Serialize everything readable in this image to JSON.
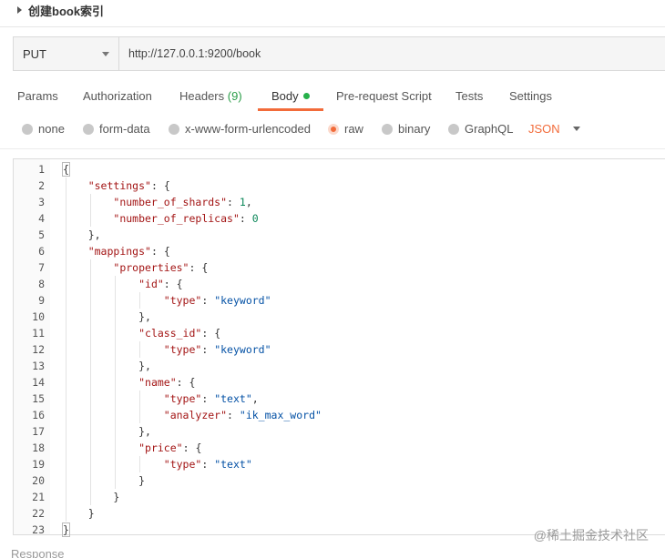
{
  "title": "创建book索引",
  "request": {
    "method": "PUT",
    "url": "http://127.0.0.1:9200/book"
  },
  "tabs": [
    {
      "label": "Params"
    },
    {
      "label": "Authorization"
    },
    {
      "label": "Headers",
      "count": "(9)"
    },
    {
      "label": "Body",
      "active": true
    },
    {
      "label": "Pre-request Script"
    },
    {
      "label": "Tests"
    },
    {
      "label": "Settings"
    }
  ],
  "body_types": [
    {
      "label": "none"
    },
    {
      "label": "form-data"
    },
    {
      "label": "x-www-form-urlencoded"
    },
    {
      "label": "raw",
      "selected": true
    },
    {
      "label": "binary"
    },
    {
      "label": "GraphQL"
    }
  ],
  "format": "JSON",
  "code_lines": [
    "{",
    "    \"settings\": {",
    "        \"number_of_shards\": 1,",
    "        \"number_of_replicas\": 0",
    "    },",
    "    \"mappings\": {",
    "        \"properties\": {",
    "            \"id\": {",
    "                \"type\": \"keyword\"",
    "            },",
    "            \"class_id\": {",
    "                \"type\": \"keyword\"",
    "            },",
    "            \"name\": {",
    "                \"type\": \"text\",",
    "                \"analyzer\": \"ik_max_word\"",
    "            },",
    "            \"price\": {",
    "                \"type\": \"text\"",
    "            }",
    "        }",
    "    }",
    "}"
  ],
  "response_label": "Response",
  "watermark": "@稀土掘金技术社区",
  "colors": {
    "accent": "#f26b3a",
    "active_dot": "#26b04a",
    "json_key": "#a31515",
    "json_string": "#0451a5",
    "json_number": "#098658"
  }
}
